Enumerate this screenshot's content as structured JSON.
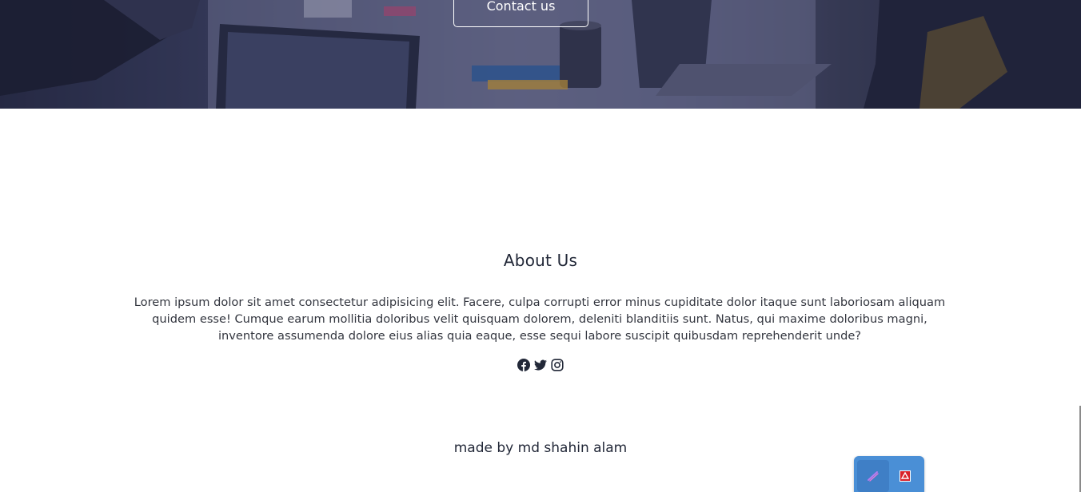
{
  "hero": {
    "contact_button": "Contact us"
  },
  "about": {
    "title": "About Us",
    "body": "Lorem ipsum dolor sit amet consectetur adipisicing elit. Facere, culpa corrupti error minus cupiditate dolor itaque sunt laboriosam aliquam quidem esse! Cumque earum mollitia doloribus velit quisquam dolorem, deleniti blanditiis sunt. Natus, qui maxime doloribus magni, inventore assumenda dolore eius alias quia eaque, esse sequi labore suscipit quibusdam reprehenderit unde?",
    "socials": [
      {
        "icon": "facebook-icon"
      },
      {
        "icon": "twitter-icon"
      },
      {
        "icon": "instagram-icon"
      }
    ]
  },
  "footer": {
    "credit": "made by md shahin alam"
  },
  "widget": {
    "tools": [
      {
        "icon": "pen-icon"
      },
      {
        "icon": "pdf-icon"
      }
    ]
  },
  "colors": {
    "hero_overlay": "#2b2f48",
    "text_dark": "#222838",
    "widget_bg": "#4a8fd6"
  }
}
